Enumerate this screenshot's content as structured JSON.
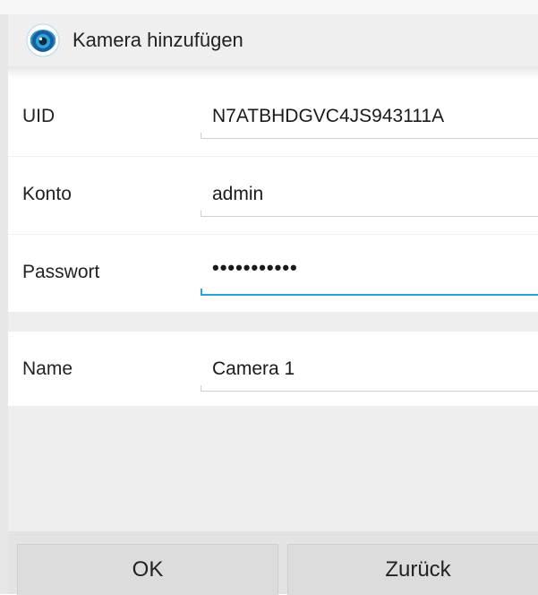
{
  "dialog": {
    "title": "Kamera hinzufügen",
    "icon": "camera-lens-icon"
  },
  "form": {
    "uid": {
      "label": "UID",
      "value": "N7ATBHDGVC4JS943111A"
    },
    "account": {
      "label": "Konto",
      "value": "admin"
    },
    "password": {
      "label": "Passwort",
      "value": "•••••••••••"
    },
    "name": {
      "label": "Name",
      "value": "Camera 1"
    }
  },
  "buttons": {
    "ok": "OK",
    "back": "Zurück"
  },
  "colors": {
    "accent": "#29a3d8",
    "header_bg": "#efefef"
  }
}
